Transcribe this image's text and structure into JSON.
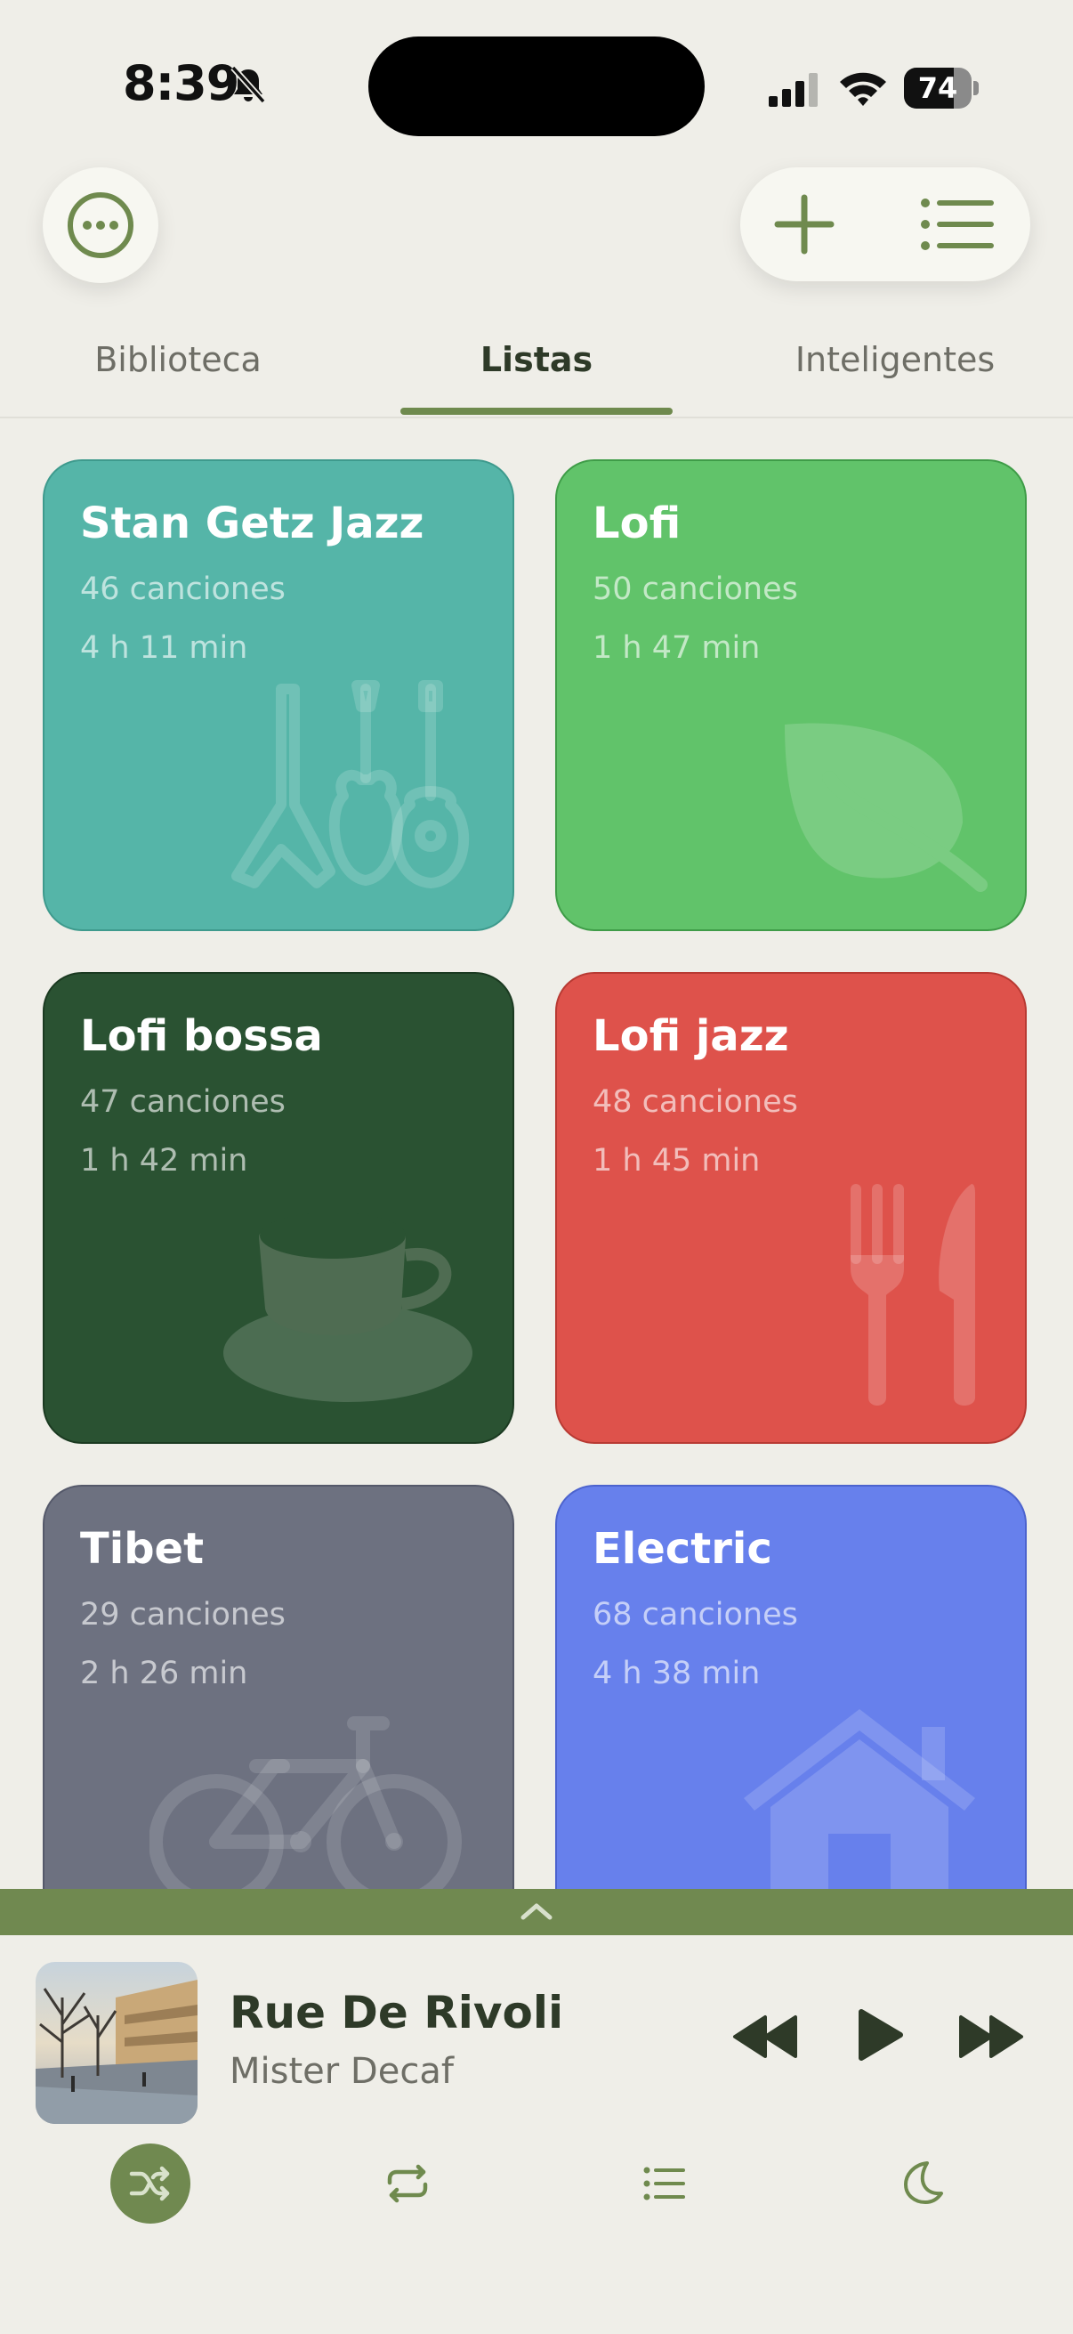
{
  "status": {
    "time": "8:39",
    "battery": "74",
    "battery_level": 0.74
  },
  "tabs": [
    {
      "label": "Biblioteca"
    },
    {
      "label": "Listas"
    },
    {
      "label": "Inteligentes"
    }
  ],
  "active_tab": "Listas",
  "playlists": [
    {
      "title": "Stan Getz Jazz",
      "count": "46 canciones",
      "duration": "4 h 11 min",
      "color": "#55B5A8",
      "icon": "guitars-icon"
    },
    {
      "title": "Lofi",
      "count": "50 canciones",
      "duration": "1 h 47 min",
      "color": "#61C36A",
      "icon": "leaf-icon"
    },
    {
      "title": "Lofi bossa",
      "count": "47 canciones",
      "duration": "1 h 42 min",
      "color": "#2A5232",
      "icon": "coffee-cup-icon"
    },
    {
      "title": "Lofi jazz",
      "count": "48 canciones",
      "duration": "1 h 45 min",
      "color": "#DE524B",
      "icon": "fork-knife-icon"
    },
    {
      "title": "Tibet",
      "count": "29 canciones",
      "duration": "2 h 26 min",
      "color": "#6D7180",
      "icon": "bicycle-icon"
    },
    {
      "title": "Electric",
      "count": "68 canciones",
      "duration": "4 h 38 min",
      "color": "#6780EC",
      "icon": "house-icon"
    }
  ],
  "now_playing": {
    "title": "Rue De Rivoli",
    "artist": "Mister Decaf"
  },
  "colors": {
    "accent": "#708950",
    "background": "#EFEEE8"
  }
}
